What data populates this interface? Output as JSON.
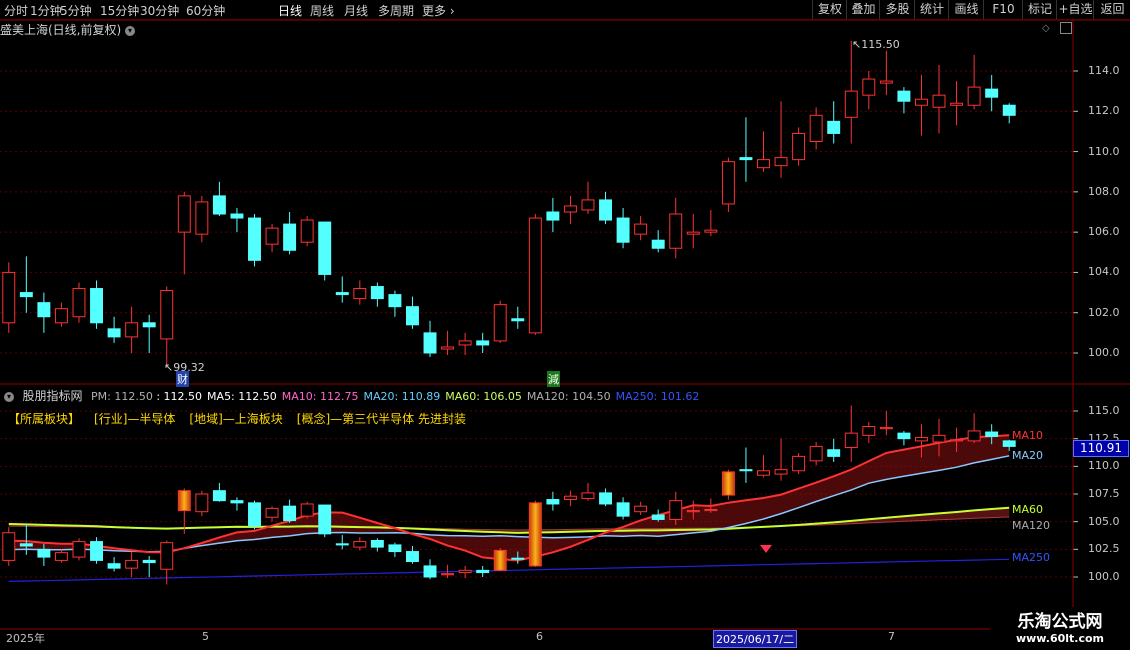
{
  "toolbar": {
    "items": [
      "分时",
      "1分钟",
      "5分钟",
      "15分钟",
      "30分钟",
      "60分钟",
      "日线",
      "周线",
      "月线",
      "多周期",
      "更多"
    ],
    "active": "日线",
    "right_items": [
      "复权",
      "叠加",
      "多股",
      "统计",
      "画线",
      "F10",
      "标记",
      "+自选",
      "返回"
    ]
  },
  "title": "盛美上海(日线,前复权)",
  "main_chart": {
    "high_label": "115.50",
    "low_label": "99.32",
    "marker_cai": "财",
    "marker_jian": "減",
    "y_ticks": [
      "114.0",
      "112.0",
      "110.0",
      "108.0",
      "106.0",
      "104.0",
      "102.0",
      "100.0"
    ]
  },
  "indicator": {
    "name": "股朋指标网",
    "pm_label": "PM: 112.50",
    "values": [
      {
        "text": ": 112.50",
        "color": "#ffffff"
      },
      {
        "text": "MA5: 112.50",
        "color": "#ffffff"
      },
      {
        "text": "MA10: 112.75",
        "color": "#ff66cc"
      },
      {
        "text": "MA20: 110.89",
        "color": "#66ccff"
      },
      {
        "text": "MA60: 106.05",
        "color": "#ccff66"
      },
      {
        "text": "MA120: 104.50",
        "color": "#b0b0b0"
      },
      {
        "text": "MA250: 101.62",
        "color": "#3355ff"
      }
    ],
    "sectors": [
      "【所属板块】",
      "[行业]—半导体",
      "[地域]—上海板块",
      "[概念]—第三代半导体 先进封装"
    ],
    "y_ticks": [
      "115.0",
      "112.5",
      "110.0",
      "107.5",
      "105.0",
      "102.5",
      "100.0"
    ],
    "current_price": "110.91",
    "ma_tags": {
      "ma10": "MA10",
      "ma20": "MA20",
      "ma60": "MA60",
      "ma120": "MA120",
      "ma250": "MA250"
    }
  },
  "date_bar": {
    "ticks": [
      "2025年",
      "5",
      "6",
      "2025/06/17/二",
      "7"
    ]
  },
  "watermark": {
    "line1": "乐淘公式网",
    "line2": "www.60lt.com"
  },
  "colors": {
    "up": "#ff3232",
    "down": "#54ffff",
    "grid": "#5a0000",
    "ma10": "#ff3232",
    "ma20": "#8cc8ff",
    "ma60": "#c8ff32",
    "ma250": "#2222dd"
  },
  "chart_data": {
    "type": "candlestick",
    "candles": [
      {
        "o": 101.5,
        "c": 104.0,
        "h": 104.5,
        "l": 101.0
      },
      {
        "o": 103.0,
        "c": 102.8,
        "h": 104.8,
        "l": 102.0
      },
      {
        "o": 102.5,
        "c": 101.8,
        "h": 103.0,
        "l": 101.0
      },
      {
        "o": 101.5,
        "c": 102.2,
        "h": 102.5,
        "l": 101.3
      },
      {
        "o": 101.8,
        "c": 103.2,
        "h": 103.5,
        "l": 101.5
      },
      {
        "o": 103.2,
        "c": 101.5,
        "h": 103.6,
        "l": 101.2
      },
      {
        "o": 101.2,
        "c": 100.8,
        "h": 101.8,
        "l": 100.5
      },
      {
        "o": 100.8,
        "c": 101.5,
        "h": 102.3,
        "l": 100.0
      },
      {
        "o": 101.5,
        "c": 101.3,
        "h": 101.9,
        "l": 100.0
      },
      {
        "o": 100.7,
        "c": 103.1,
        "h": 103.3,
        "l": 99.32
      },
      {
        "o": 106.0,
        "c": 107.8,
        "h": 108.0,
        "l": 103.9
      },
      {
        "o": 105.9,
        "c": 107.5,
        "h": 107.8,
        "l": 105.5
      },
      {
        "o": 107.8,
        "c": 106.9,
        "h": 108.5,
        "l": 106.8
      },
      {
        "o": 106.9,
        "c": 106.7,
        "h": 107.2,
        "l": 106.0
      },
      {
        "o": 106.7,
        "c": 104.6,
        "h": 106.9,
        "l": 104.3
      },
      {
        "o": 105.4,
        "c": 106.2,
        "h": 106.4,
        "l": 105.0
      },
      {
        "o": 106.4,
        "c": 105.1,
        "h": 107.0,
        "l": 104.9
      },
      {
        "o": 105.5,
        "c": 106.6,
        "h": 106.8,
        "l": 105.3
      },
      {
        "o": 106.5,
        "c": 103.9,
        "h": 106.5,
        "l": 103.6
      },
      {
        "o": 103.0,
        "c": 102.9,
        "h": 103.8,
        "l": 102.5
      },
      {
        "o": 102.7,
        "c": 103.2,
        "h": 103.6,
        "l": 102.4
      },
      {
        "o": 103.3,
        "c": 102.7,
        "h": 103.5,
        "l": 102.3
      },
      {
        "o": 102.9,
        "c": 102.3,
        "h": 103.1,
        "l": 101.8
      },
      {
        "o": 102.3,
        "c": 101.4,
        "h": 102.8,
        "l": 101.2
      },
      {
        "o": 101.0,
        "c": 100.0,
        "h": 101.6,
        "l": 99.8
      },
      {
        "o": 100.2,
        "c": 100.3,
        "h": 101.1,
        "l": 99.9
      },
      {
        "o": 100.4,
        "c": 100.6,
        "h": 101.0,
        "l": 99.9
      },
      {
        "o": 100.6,
        "c": 100.4,
        "h": 101.0,
        "l": 100.0
      },
      {
        "o": 100.6,
        "c": 102.4,
        "h": 102.6,
        "l": 100.5
      },
      {
        "o": 101.7,
        "c": 101.6,
        "h": 102.3,
        "l": 101.2
      },
      {
        "o": 101.0,
        "c": 106.7,
        "h": 106.9,
        "l": 100.9
      },
      {
        "o": 107.0,
        "c": 106.6,
        "h": 107.7,
        "l": 106.0
      },
      {
        "o": 107.0,
        "c": 107.3,
        "h": 107.8,
        "l": 106.4
      },
      {
        "o": 107.1,
        "c": 107.6,
        "h": 108.5,
        "l": 106.9
      },
      {
        "o": 107.6,
        "c": 106.6,
        "h": 108.0,
        "l": 106.4
      },
      {
        "o": 106.7,
        "c": 105.5,
        "h": 107.2,
        "l": 105.2
      },
      {
        "o": 105.9,
        "c": 106.4,
        "h": 106.8,
        "l": 105.6
      },
      {
        "o": 105.6,
        "c": 105.2,
        "h": 106.1,
        "l": 105.0
      },
      {
        "o": 105.2,
        "c": 106.9,
        "h": 107.7,
        "l": 104.7
      },
      {
        "o": 105.9,
        "c": 106.0,
        "h": 106.9,
        "l": 105.2
      },
      {
        "o": 106.0,
        "c": 106.1,
        "h": 107.1,
        "l": 105.8
      },
      {
        "o": 107.4,
        "c": 109.5,
        "h": 109.7,
        "l": 107.0
      },
      {
        "o": 109.7,
        "c": 109.6,
        "h": 111.7,
        "l": 108.5
      },
      {
        "o": 109.2,
        "c": 109.6,
        "h": 111.0,
        "l": 109.0
      },
      {
        "o": 109.3,
        "c": 109.7,
        "h": 112.5,
        "l": 108.7
      },
      {
        "o": 109.6,
        "c": 110.9,
        "h": 111.2,
        "l": 109.3
      },
      {
        "o": 110.5,
        "c": 111.8,
        "h": 112.2,
        "l": 110.1
      },
      {
        "o": 111.5,
        "c": 110.9,
        "h": 112.5,
        "l": 110.4
      },
      {
        "o": 111.7,
        "c": 113.0,
        "h": 115.5,
        "l": 110.4
      },
      {
        "o": 112.8,
        "c": 113.6,
        "h": 114.0,
        "l": 112.1
      },
      {
        "o": 113.4,
        "c": 113.5,
        "h": 115.0,
        "l": 112.8
      },
      {
        "o": 113.0,
        "c": 112.5,
        "h": 113.2,
        "l": 111.9
      },
      {
        "o": 112.3,
        "c": 112.6,
        "h": 113.8,
        "l": 110.8
      },
      {
        "o": 112.2,
        "c": 112.8,
        "h": 114.3,
        "l": 110.9
      },
      {
        "o": 112.3,
        "c": 112.4,
        "h": 113.5,
        "l": 111.3
      },
      {
        "o": 112.3,
        "c": 113.2,
        "h": 114.8,
        "l": 112.1
      },
      {
        "o": 113.1,
        "c": 112.7,
        "h": 113.8,
        "l": 112.0
      },
      {
        "o": 112.3,
        "c": 111.8,
        "h": 112.4,
        "l": 111.4
      }
    ],
    "y_range_main": [
      99.0,
      115.8
    ],
    "y_range_ind": [
      99.0,
      115.8
    ]
  }
}
